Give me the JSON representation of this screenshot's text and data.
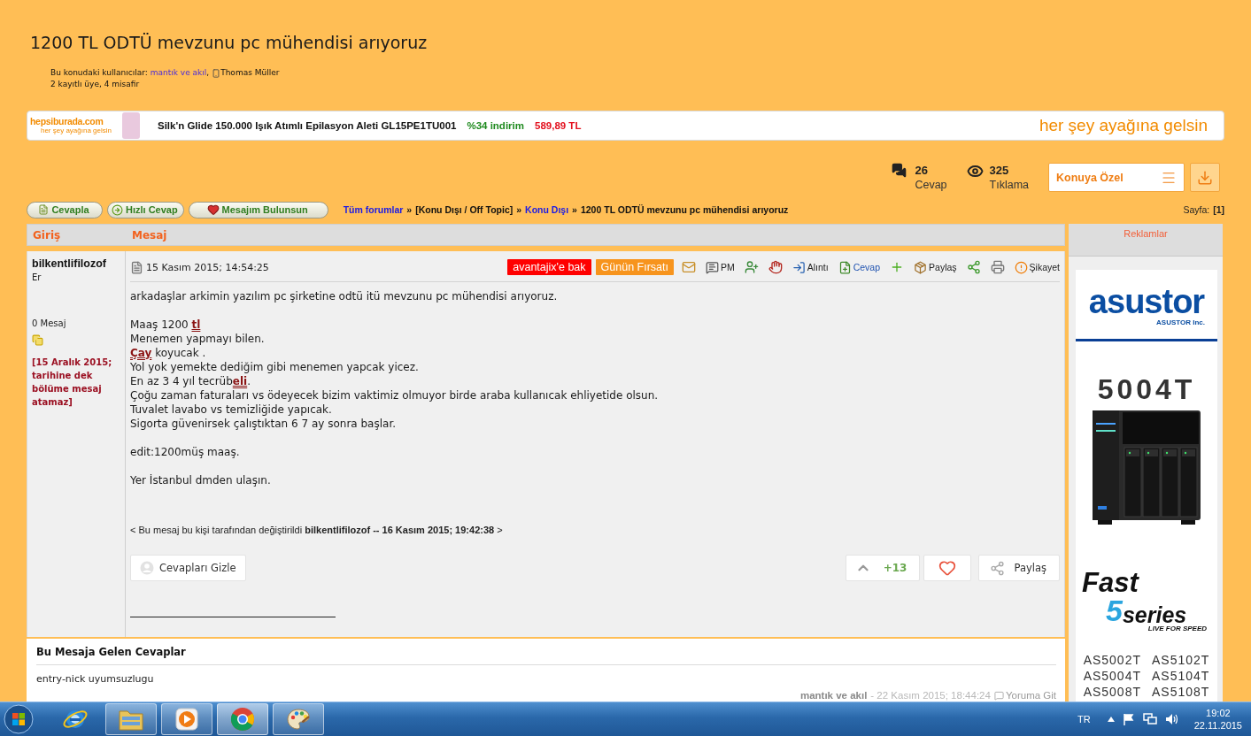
{
  "title": "1200 TL ODTÜ mevzunu pc mühendisi arıyoruz",
  "viewers": {
    "label": "Bu konudaki kullanıcılar:",
    "users": [
      {
        "name": "mantık ve akıl",
        "kind": "member",
        "separator": ","
      },
      {
        "name": "Thomas Müller",
        "kind": "mobile"
      }
    ],
    "summary": "2 kayıtlı üye, 4 misafir"
  },
  "banner_ad": {
    "logo": "hepsiburada.com",
    "logo_tagline": "her şey ayağına gelsin",
    "product": "Silk'n Glide 150.000 Işık Atımlı Epilasyon Aleti GL15PE1TU001",
    "discount": "%34 indirim",
    "price": "589,89 TL",
    "slogan": "her şey ayağına gelsin"
  },
  "stats": [
    {
      "kind": "replies",
      "value": "26",
      "label": "Cevap"
    },
    {
      "kind": "views",
      "value": "325",
      "label": "Tıklama"
    }
  ],
  "topic_menu": {
    "label": "Konuya Özel"
  },
  "toolbar": [
    {
      "kind": "reply",
      "label": "Cevapla"
    },
    {
      "kind": "quick-reply",
      "label": "Hızlı Cevap"
    },
    {
      "kind": "follow",
      "label": "Mesajım Bulunsun"
    }
  ],
  "breadcrumb": [
    {
      "text": "Tüm forumlar",
      "kind": "link",
      "separator": "»"
    },
    {
      "text": "[Konu Dışı / Off Topic]",
      "kind": "plain",
      "separator": "»"
    },
    {
      "text": "Konu Dışı",
      "kind": "link",
      "separator": "»"
    },
    {
      "text": "1200 TL ODTÜ mevzunu pc mühendisi arıyoruz",
      "kind": "plain"
    }
  ],
  "pagination": {
    "label": "Sayfa:",
    "current": "[1]"
  },
  "table": {
    "columns": [
      "Giriş",
      "Mesaj"
    ]
  },
  "post": {
    "author": "bilkentlifilozof",
    "rank": "Er",
    "message_count": "0 Mesaj",
    "ban_note": "[15 Aralık 2015; tarihine dek bölüme mesaj atamaz]",
    "date": "15 Kasım 2015; 14:54:25",
    "badges": [
      {
        "text": "avantajix'e bak",
        "color": "#ff0000"
      },
      {
        "text": "Günün Fırsatı",
        "color": "#f7941d"
      }
    ],
    "actions": [
      {
        "kind": "email"
      },
      {
        "kind": "pm",
        "label": "PM"
      },
      {
        "kind": "add-friend"
      },
      {
        "kind": "block"
      },
      {
        "kind": "quote",
        "label": "Alıntı"
      },
      {
        "kind": "reply",
        "label": "Cevap"
      },
      {
        "kind": "plus"
      },
      {
        "kind": "share",
        "label": "Paylaş"
      },
      {
        "kind": "share-network"
      },
      {
        "kind": "print"
      },
      {
        "kind": "report",
        "label": "Şikayet"
      }
    ],
    "paragraphs": [
      {
        "lines": [
          {
            "segments": [
              {
                "kind": "text",
                "text": "arkadaşlar arkimin yazılım pc şirketine odtü itü mevzunu pc mühendisi arıyoruz."
              }
            ]
          }
        ]
      },
      {
        "lines": [
          {
            "segments": [
              {
                "kind": "text",
                "text": "Maaş 1200 "
              },
              {
                "kind": "keyword",
                "text": "tl"
              }
            ]
          },
          {
            "segments": [
              {
                "kind": "text",
                "text": "Menemen yapmayı bilen."
              }
            ]
          },
          {
            "segments": [
              {
                "kind": "keyword",
                "text": "Çay"
              },
              {
                "kind": "text",
                "text": " koyucak ."
              }
            ]
          },
          {
            "segments": [
              {
                "kind": "text",
                "text": "Yol yok yemekte dediğim gibi menemen yapcak yicez."
              }
            ]
          },
          {
            "segments": [
              {
                "kind": "text",
                "text": "En az 3 4 yıl tecrüb"
              },
              {
                "kind": "keyword",
                "text": "eli"
              },
              {
                "kind": "text",
                "text": "."
              }
            ]
          },
          {
            "segments": [
              {
                "kind": "text",
                "text": "Çoğu zaman faturaları vs ödeyecek bizim vaktimiz olmuyor birde araba kullanıcak ehliyetide olsun."
              }
            ]
          },
          {
            "segments": [
              {
                "kind": "text",
                "text": "Tuvalet lavabo vs temizliğide yapıcak."
              }
            ]
          },
          {
            "segments": [
              {
                "kind": "text",
                "text": "Sigorta güvenirsek çalıştıktan 6 7 ay sonra başlar."
              }
            ]
          }
        ]
      },
      {
        "lines": [
          {
            "segments": [
              {
                "kind": "text",
                "text": "edit:1200müş maaş."
              }
            ]
          }
        ]
      },
      {
        "lines": [
          {
            "segments": [
              {
                "kind": "text",
                "text": "Yer İstanbul dmden ulaşın."
              }
            ]
          }
        ]
      }
    ],
    "edit_note": "< Bu mesaj bu kişi tarafından değiştirildi **bilkentlifilozof -- 16 Kasım 2015; 19:42:38** >",
    "hide_replies": "Cevapları Gizle",
    "votes": "+13",
    "liked": false,
    "share_label": "Paylaş"
  },
  "replies": {
    "title": "Bu Mesaja Gelen Cevaplar",
    "items": [
      {
        "text": "entry-nick uyumsuzlugu",
        "author": "mantık ve akıl",
        "date": "- 22 Kasım 2015; 18:44:24",
        "link": "Yoruma Git"
      }
    ]
  },
  "sidebar": {
    "title": "Reklamlar",
    "ad": {
      "brand": "asustor",
      "brand_sub": "ASUSTOR Inc.",
      "model": "5004T",
      "series_title": "Fast",
      "series_number": "5",
      "series_name": "series",
      "series_tagline": "LIVE FOR SPEED",
      "models": [
        "AS5002T",
        "AS5102T",
        "AS5004T",
        "AS5104T",
        "AS5008T",
        "AS5108T"
      ]
    }
  },
  "taskbar": {
    "apps": [
      {
        "kind": "ie",
        "running": false,
        "selected": false
      },
      {
        "kind": "explorer",
        "running": true,
        "selected": false
      },
      {
        "kind": "media",
        "running": true,
        "selected": false
      },
      {
        "kind": "chrome",
        "running": true,
        "selected": true
      },
      {
        "kind": "paint",
        "running": true,
        "selected": false
      }
    ],
    "language": "TR",
    "time": "19:02",
    "date": "22.11.2015"
  }
}
